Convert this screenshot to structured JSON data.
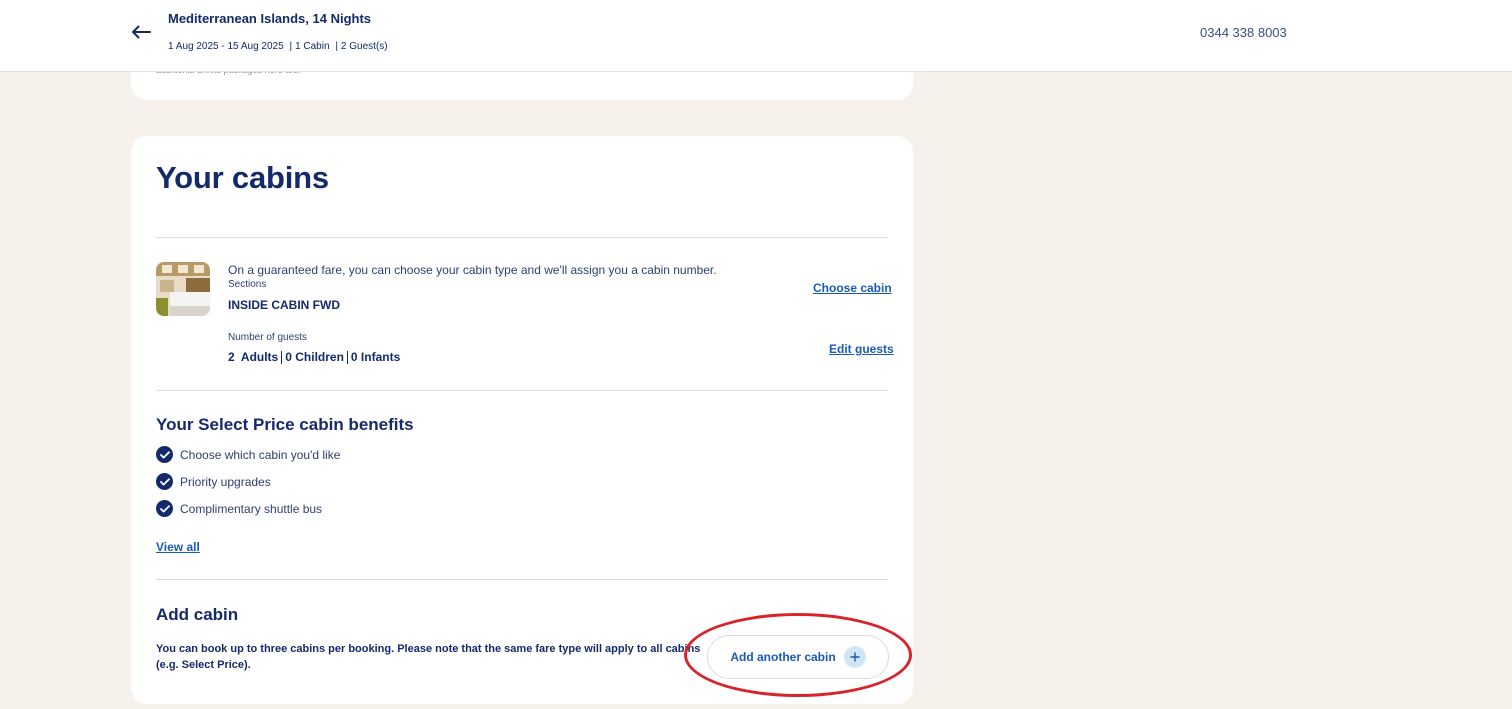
{
  "header": {
    "back_icon": "arrow-left-icon",
    "title": "Mediterranean Islands, 14 Nights",
    "dates": "1 Aug 2025 - 15 Aug 2025",
    "cabins": "1 Cabin",
    "guests": "2 Guest(s)",
    "meta_separator": "|",
    "phone": "0344 338 8003"
  },
  "previous_section": {
    "snippet": "additional drinks packages here too."
  },
  "cabins_section": {
    "title": "Your cabins",
    "cabin": {
      "image_icon": "cabin-photo",
      "notice": "On a guaranteed fare, you can choose your cabin type and we'll assign you a cabin number.",
      "sections_label": "Sections",
      "sections_value": "INSIDE CABIN FWD",
      "choose_cabin_link": "Choose cabin",
      "guests_label": "Number of guests",
      "adults": "2  Adults",
      "children": "0 Children",
      "infants": "0 Infants",
      "edit_guests_link": "Edit guests"
    },
    "benefits": {
      "title": "Your Select Price cabin benefits",
      "items": [
        "Choose which cabin you'd like",
        "Priority upgrades",
        "Complimentary shuttle bus"
      ],
      "view_all_link": "View all"
    },
    "add_cabin": {
      "title": "Add cabin",
      "description": "You can book up to three cabins per booking. Please note that the same fare type will apply to all cabins (e.g. Select Price).",
      "button_label": "Add another cabin",
      "button_icon": "plus-icon"
    }
  },
  "colors": {
    "navy": "#142a6b",
    "link_blue": "#1a5ab8",
    "page_bg": "#f6f1eb",
    "annotation_red": "#d8232a"
  }
}
